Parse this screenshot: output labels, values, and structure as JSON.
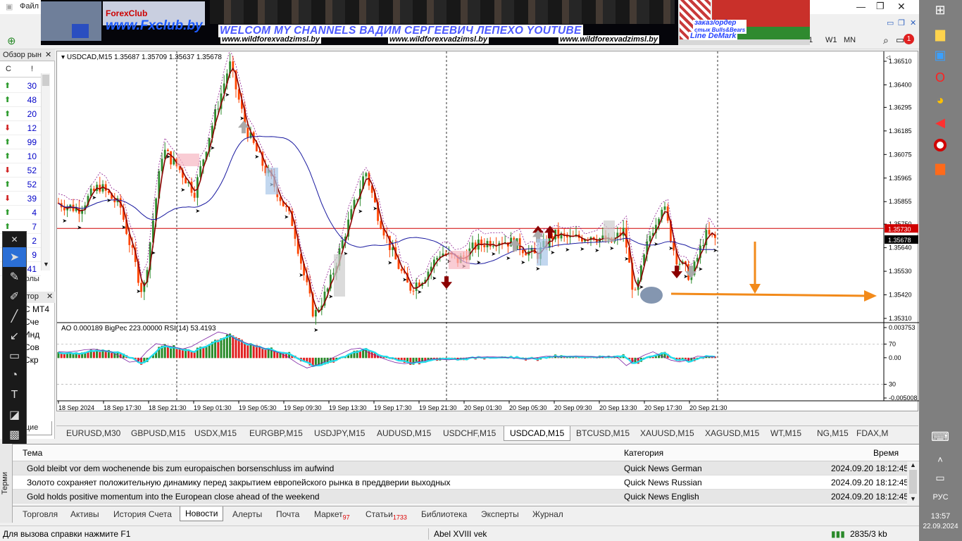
{
  "window": {
    "menu_first": "Файл"
  },
  "banner": {
    "logo_text": "ForexClub",
    "logo_site": "www.Fxclub.by",
    "welcome": "WELCOM MY CHANNELS ВАДИМ СЕРГЕЕВИЧ ЛЕПЕХО YOUTUBE",
    "url": "www.wildforexvadzimsl.by",
    "order_line1": "заказ/ордер",
    "order_line2": "стык Bulls&Bears",
    "order_line3": "Line DeMark"
  },
  "toolbar": {
    "timeframes": [
      "1",
      "W1",
      "MN"
    ],
    "notification_count": "1"
  },
  "market_watch": {
    "title": "Обзор рын",
    "col_symbol": "С",
    "col_sort": "!",
    "rows": [
      {
        "dir": "up",
        "value": "30"
      },
      {
        "dir": "up",
        "value": "48"
      },
      {
        "dir": "up",
        "value": "20"
      },
      {
        "dir": "down",
        "value": "12"
      },
      {
        "dir": "up",
        "value": "99"
      },
      {
        "dir": "up",
        "value": "10"
      },
      {
        "dir": "down",
        "value": "52"
      },
      {
        "dir": "up",
        "value": "52"
      },
      {
        "dir": "down",
        "value": "39"
      },
      {
        "dir": "up",
        "value": "4"
      },
      {
        "dir": "up",
        "value": "7"
      },
      {
        "dir": "up",
        "value": "2"
      },
      {
        "dir": "up",
        "value": "9"
      },
      {
        "dir": "up",
        "value": "41"
      }
    ],
    "tab_symbols": "волы"
  },
  "navigator": {
    "title": "атор",
    "items": [
      "С МТ4",
      "Сче",
      "Инд",
      "Сов",
      "Скр"
    ],
    "tab": "щие"
  },
  "chart": {
    "header": "USDCAD,M15  1.35687 1.35709 1.35637 1.35678",
    "price_ticks": [
      "1.36510",
      "1.36400",
      "1.36295",
      "1.36185",
      "1.36075",
      "1.35965",
      "1.35855",
      "1.35750",
      "1.35640",
      "1.35530",
      "1.35420",
      "1.35310"
    ],
    "bid_label": "1.35730",
    "last_label": "1.35678",
    "indicator_header": "AO 0.000189  BigPec 223.00000  RSI(14) 53.4193",
    "indicator_ticks": [
      "0.003753",
      "70",
      "0.00",
      "30",
      "-0.005008"
    ],
    "time_ticks": [
      "18 Sep 2024",
      "18 Sep 17:30",
      "18 Sep 21:30",
      "19 Sep 01:30",
      "19 Sep 05:30",
      "19 Sep 09:30",
      "19 Sep 13:30",
      "19 Sep 17:30",
      "19 Sep 21:30",
      "20 Sep 01:30",
      "20 Sep 05:30",
      "20 Sep 09:30",
      "20 Sep 13:30",
      "20 Sep 17:30",
      "20 Sep 21:30"
    ],
    "bull_color": "#2e8b2e",
    "bear_color": "#ff4500",
    "level_color": "#d00000",
    "arrow_color": "#f28a1a"
  },
  "chart_tabs": [
    "EURUSD,M30",
    "GBPUSD,M15",
    "USDX,M15",
    "EURGBP,M15",
    "USDJPY,M15",
    "AUDUSD,M15",
    "USDCHF,M15",
    "USDCAD,M15",
    "BTCUSD,M15",
    "XAUUSD,M15",
    "XAGUSD,M15",
    "WT,M15",
    "NG,M15",
    "FDAX,M"
  ],
  "active_chart_tab": "USDCAD,M15",
  "news": {
    "col_title": "Тема",
    "col_category": "Категория",
    "col_time": "Время",
    "rows": [
      {
        "title": "Gold bleibt vor dem wochenende bis zum europaischen borsenschluss im aufwind",
        "category": "Quick News German",
        "time": "2024.09.20 18:12:45"
      },
      {
        "title": "Золото сохраняет положительную динамику перед закрытием европейского рынка в преддверии выходных",
        "category": "Quick News Russian",
        "time": "2024.09.20 18:12:45"
      },
      {
        "title": "Gold holds positive momentum into the European close ahead of the weekend",
        "category": "Quick News English",
        "time": "2024.09.20 18:12:45"
      }
    ]
  },
  "bottom_tabs": [
    {
      "label": "Торговля"
    },
    {
      "label": "Активы"
    },
    {
      "label": "История Счета"
    },
    {
      "label": "Новости",
      "active": true
    },
    {
      "label": "Алерты"
    },
    {
      "label": "Почта"
    },
    {
      "label": "Маркет",
      "badge": "97"
    },
    {
      "label": "Статьи",
      "badge": "1733"
    },
    {
      "label": "Библиотека"
    },
    {
      "label": "Эксперты"
    },
    {
      "label": "Журнал"
    }
  ],
  "terminal_label": "Терми",
  "status": {
    "help": "Для вызова справки нажмите F1",
    "profile": "Abel XVIII vek",
    "traffic": "2835/3 kb"
  },
  "taskbar": {
    "lang": "РУС",
    "time": "13:57",
    "date": "22.09.2024"
  }
}
